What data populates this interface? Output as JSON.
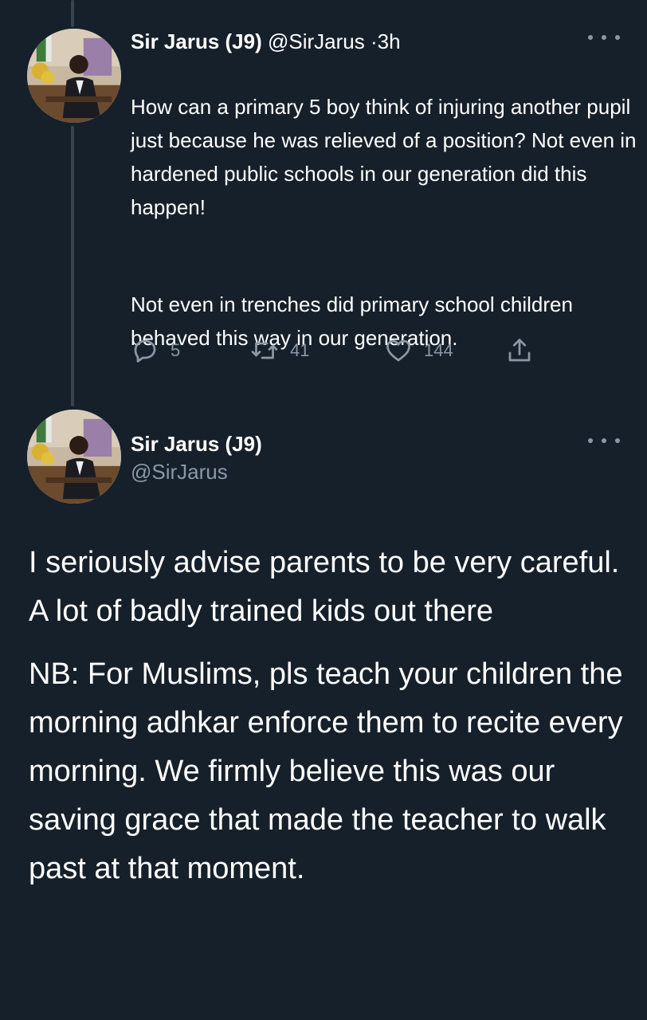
{
  "tweet1": {
    "name": "Sir Jarus (J9)",
    "handle": "@SirJarus",
    "separator": "·",
    "time": "3h",
    "paragraphs": [
      "How can a primary 5 boy think of injuring another pupil just because he was relieved of a position? Not even in hardened public schools in our generation did this happen!",
      "Not even in trenches did primary school children behaved this way in our generation."
    ],
    "replies": "5",
    "retweets": "41",
    "likes": "144",
    "icons": [
      "reply-icon",
      "retweet-icon",
      "like-icon",
      "share-icon",
      "more-icon"
    ]
  },
  "tweet2": {
    "name": "Sir Jarus (J9)",
    "handle": "@SirJarus",
    "paragraphs": [
      "I seriously advise parents to be very careful. A lot of badly trained kids out there",
      "NB: For Muslims, pls teach your children the morning adhkar enforce them to recite every morning. We firmly believe this was our saving grace that made the teacher to walk past at that moment."
    ]
  },
  "colors": {
    "background": "#15202b",
    "text": "#ffffff",
    "secondary": "#8b98a5",
    "thread_line": "#38444d"
  }
}
